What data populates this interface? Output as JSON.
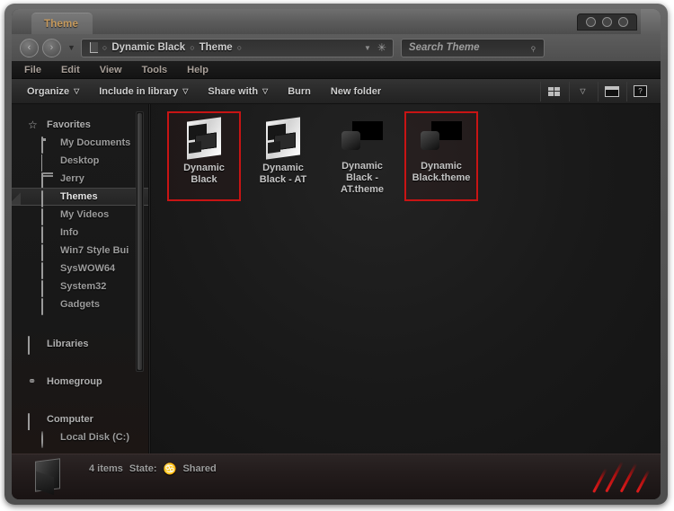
{
  "window": {
    "title": "Theme",
    "controls": [
      "minimize",
      "maximize",
      "close"
    ]
  },
  "navigation": {
    "back_glyph": "‹",
    "forward_glyph": "›",
    "history_glyph": "▼",
    "breadcrumbs": [
      "Dynamic Black",
      "Theme"
    ],
    "separator_glyph": "○",
    "chevron_glyph": "▼",
    "refresh_glyph": "✳"
  },
  "search": {
    "placeholder": "Search Theme",
    "value": "Search Theme",
    "icon_glyph": "⌕"
  },
  "menu": {
    "items": [
      {
        "label": "File"
      },
      {
        "label": "Edit"
      },
      {
        "label": "View"
      },
      {
        "label": "Tools"
      },
      {
        "label": "Help"
      }
    ]
  },
  "toolbar": {
    "items": [
      {
        "label": "Organize",
        "caret": "▽"
      },
      {
        "label": "Include in library",
        "caret": "▽"
      },
      {
        "label": "Share with",
        "caret": "▽"
      },
      {
        "label": "Burn",
        "caret": ""
      },
      {
        "label": "New folder",
        "caret": ""
      }
    ],
    "view_caret": "▽",
    "help_glyph": "?"
  },
  "sidebar": {
    "groups": [
      {
        "header": {
          "label": "Favorites",
          "icon": "star-icon"
        },
        "items": [
          {
            "label": "My Documents",
            "icon": "folder-open-icon",
            "selected": false
          },
          {
            "label": "Desktop",
            "icon": "desktop-icon",
            "selected": false
          },
          {
            "label": "Jerry",
            "icon": "folder-icon",
            "selected": false
          },
          {
            "label": "Themes",
            "icon": "folder-icon",
            "selected": true
          },
          {
            "label": "My Videos",
            "icon": "folder-icon",
            "selected": false
          },
          {
            "label": "Info",
            "icon": "folder-icon",
            "selected": false
          },
          {
            "label": "Win7 Style Bui",
            "icon": "folder-icon",
            "selected": false
          },
          {
            "label": "SysWOW64",
            "icon": "folder-icon",
            "selected": false
          },
          {
            "label": "System32",
            "icon": "folder-icon",
            "selected": false
          },
          {
            "label": "Gadgets",
            "icon": "folder-icon",
            "selected": false
          }
        ]
      },
      {
        "header": {
          "label": "Libraries",
          "icon": "library-icon"
        },
        "items": []
      },
      {
        "header": {
          "label": "Homegroup",
          "icon": "homegroup-icon"
        },
        "items": []
      },
      {
        "header": {
          "label": "Computer",
          "icon": "computer-icon"
        },
        "items": [
          {
            "label": "Local Disk (C:)",
            "icon": "disk-icon",
            "selected": false
          }
        ]
      }
    ]
  },
  "files": [
    {
      "name": "Dynamic Black",
      "icon": "folder-icon",
      "selected": true
    },
    {
      "name": "Dynamic Black - AT",
      "icon": "folder-icon",
      "selected": false
    },
    {
      "name": "Dynamic Black - AT.theme",
      "icon": "theme-file-icon",
      "selected": false
    },
    {
      "name": "Dynamic Black.theme",
      "icon": "theme-file-icon",
      "selected": true
    }
  ],
  "status": {
    "item_count": "4 items",
    "state_label": "State:",
    "state_glyph": "♋",
    "state_value": "Shared"
  },
  "colors": {
    "selection_red": "#c81414",
    "title_accent": "#c79a5c",
    "window_chrome": "#5a5a5a",
    "content_bg": "#191919"
  }
}
